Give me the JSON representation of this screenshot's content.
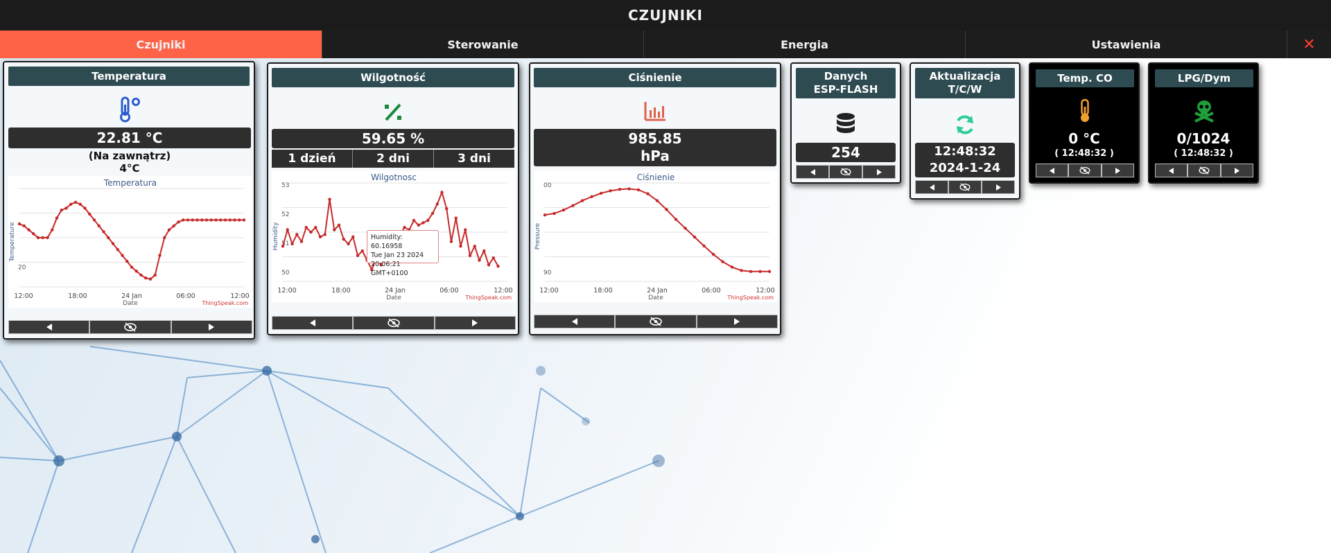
{
  "header": {
    "title": "CZUJNIKI"
  },
  "tabs": [
    {
      "label": "Czujniki",
      "active": true
    },
    {
      "label": "Sterowanie"
    },
    {
      "label": "Energia"
    },
    {
      "label": "Ustawienia"
    }
  ],
  "close_glyph": "✕",
  "colors": {
    "accent": "#ff6347",
    "card_title_bg": "#2e4b52",
    "value_bg": "#2e2e2e",
    "chart_line": "#c62828"
  },
  "temperature": {
    "title": "Temperatura",
    "icon": "thermometer-icon",
    "value": "22.81 °C",
    "outside_label": "(Na zawnątrz)",
    "outside_value": "4°C"
  },
  "humidity": {
    "title": "Wilgotność",
    "icon": "percent-icon",
    "value": "59.65 %",
    "ranges": [
      "1 dzień",
      "2 dni",
      "3 dni"
    ],
    "tooltip": {
      "line1": "Humidity: 60.16958",
      "line2": "Tue Jan 23 2024",
      "line3": "20:06:21 GMT+0100"
    }
  },
  "pressure": {
    "title": "Ciśnienie",
    "icon": "bar-chart-icon",
    "value": "985.85",
    "unit": "hPa"
  },
  "flash": {
    "title_line1": "Danych",
    "title_line2": "ESP-FLASH",
    "icon": "database-icon",
    "value": "254"
  },
  "update": {
    "title_line1": "Aktualizacja",
    "title_line2": "T/C/W",
    "icon": "refresh-icon",
    "time": "12:48:32",
    "date": "2024-1-24"
  },
  "co": {
    "title": "Temp. CO",
    "icon": "thermometer-icon",
    "value": "0 °C",
    "time": "( 12:48:32 )"
  },
  "lpg": {
    "title": "LPG/Dym",
    "icon": "skull-icon",
    "value": "0/1024",
    "time": "( 12:48:32 )"
  },
  "chart_data": [
    {
      "type": "line",
      "title": "Temperatura",
      "xlabel": "Date",
      "ylabel": "Temperature",
      "xticks": [
        "12:00",
        "18:00",
        "24 Jan",
        "06:00",
        "12:00"
      ],
      "yticks": [
        "20"
      ],
      "credit": "ThingSpeak.com",
      "ylim": [
        19,
        24
      ],
      "x": [
        0,
        0.5,
        1,
        1.5,
        2,
        2.5,
        3,
        3.5,
        4,
        4.5,
        5,
        5.5,
        6,
        6.5,
        7,
        7.5,
        8,
        8.5,
        9,
        9.5,
        10,
        10.5,
        11,
        11.5,
        12,
        12.5,
        13,
        13.5,
        14,
        14.5,
        15,
        15.5,
        16,
        16.5,
        17,
        17.5,
        18,
        18.5,
        19,
        19.5,
        20,
        20.5,
        21,
        21.5,
        22,
        22.5,
        23,
        23.5,
        24
      ],
      "values": [
        22.2,
        22.1,
        21.9,
        21.7,
        21.5,
        21.5,
        21.5,
        21.9,
        22.5,
        22.9,
        23.0,
        23.2,
        23.3,
        23.2,
        23.0,
        22.7,
        22.4,
        22.1,
        21.8,
        21.5,
        21.2,
        20.9,
        20.6,
        20.3,
        20.0,
        19.8,
        19.6,
        19.45,
        19.4,
        19.6,
        20.6,
        21.5,
        21.9,
        22.1,
        22.3,
        22.4,
        22.4,
        22.4,
        22.4,
        22.4,
        22.4,
        22.4,
        22.4,
        22.4,
        22.4,
        22.4,
        22.4,
        22.4,
        22.4
      ]
    },
    {
      "type": "line",
      "title": "Wilgotnosc",
      "xlabel": "Date",
      "ylabel": "Humidity",
      "xticks": [
        "12:00",
        "18:00",
        "24 Jan",
        "06:00",
        "12:00"
      ],
      "yticks": [
        "53",
        "52",
        "51",
        "50"
      ],
      "credit": "ThingSpeak.com",
      "ylim": [
        49.3,
        53.5
      ],
      "x": [
        0,
        0.5,
        1,
        1.5,
        2,
        2.5,
        3,
        3.5,
        4,
        4.5,
        5,
        5.5,
        6,
        6.5,
        7,
        7.5,
        8,
        8.5,
        9,
        9.5,
        10,
        10.5,
        11,
        11.5,
        12,
        12.5,
        13,
        13.5,
        14,
        14.5,
        15,
        15.5,
        16,
        16.5,
        17,
        17.5,
        18,
        18.5,
        19,
        19.5,
        20,
        20.5,
        21,
        21.5,
        22,
        22.5,
        23
      ],
      "values": [
        50.8,
        51.5,
        50.9,
        51.3,
        51.0,
        51.6,
        51.4,
        51.6,
        51.2,
        51.3,
        52.8,
        51.5,
        51.7,
        51.1,
        50.9,
        51.2,
        50.4,
        50.6,
        50.2,
        49.8,
        50.3,
        50.0,
        50.6,
        50.4,
        51.0,
        51.3,
        51.6,
        51.5,
        51.9,
        51.7,
        51.8,
        51.9,
        52.2,
        52.6,
        53.1,
        52.4,
        51.0,
        52.0,
        50.8,
        51.5,
        50.4,
        50.8,
        50.2,
        50.6,
        50.0,
        50.3,
        49.95
      ]
    },
    {
      "type": "line",
      "title": "Ciśnienie",
      "xlabel": "Date",
      "ylabel": "Pressure",
      "xticks": [
        "12:00",
        "18:00",
        "24 Jan",
        "06:00",
        "12:00"
      ],
      "yticks": [
        "00",
        "90"
      ],
      "credit": "ThingSpeak.com",
      "ylim": [
        983,
        1003
      ],
      "x": [
        0,
        1,
        2,
        3,
        4,
        5,
        6,
        7,
        8,
        9,
        10,
        11,
        12,
        13,
        14,
        15,
        16,
        17,
        18,
        19,
        20,
        21,
        22,
        23,
        24
      ],
      "values": [
        996.5,
        996.8,
        997.5,
        998.4,
        999.4,
        1000.2,
        1000.9,
        1001.4,
        1001.7,
        1001.8,
        1001.6,
        1000.8,
        999.4,
        997.6,
        995.6,
        993.8,
        992.0,
        990.2,
        988.5,
        987.0,
        985.9,
        985.2,
        985.0,
        985.0,
        985.0
      ]
    }
  ]
}
